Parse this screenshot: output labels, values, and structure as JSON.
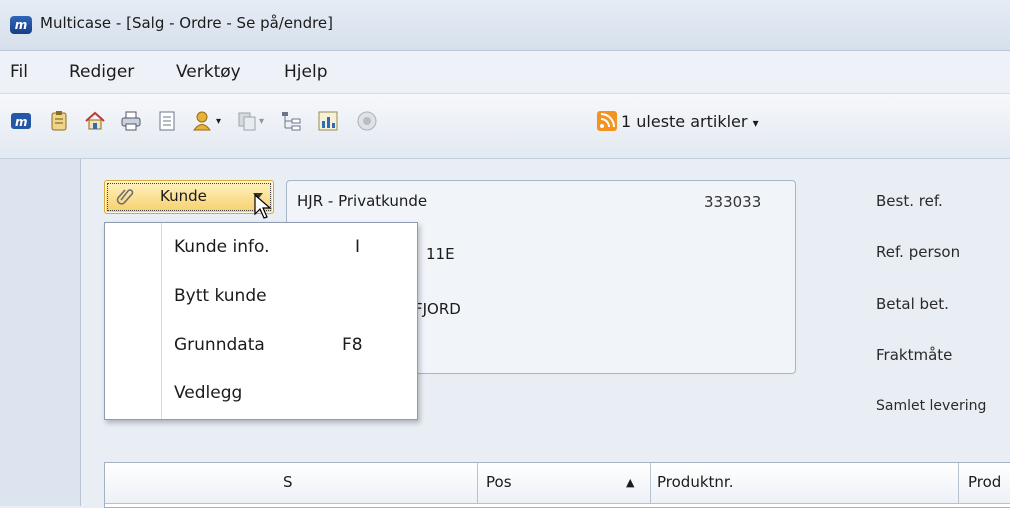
{
  "window": {
    "title": "Multicase - [Salg - Ordre - Se på/endre]",
    "app_icon_text": "m"
  },
  "menubar": {
    "items": [
      "Fil",
      "Rediger",
      "Verktøy",
      "Hjelp"
    ]
  },
  "toolbar": {
    "icons": [
      "multicase-icon",
      "clipboard-icon",
      "home-icon",
      "printer-icon",
      "document-icon",
      "user-icon",
      "copy-icon",
      "tree-icon",
      "chart-icon",
      "info-icon",
      "rss-icon"
    ],
    "rss_label": "1 uleste artikler",
    "rss_arrow": "▾"
  },
  "customer": {
    "button_label": "Kunde",
    "name": "HJR - Privatkunde",
    "number": "333033",
    "address_line1_partial": "11E",
    "address_line2_partial": "FJORD"
  },
  "dropdown": {
    "items": [
      {
        "label": "Kunde info.",
        "shortcut": "I"
      },
      {
        "label": "Bytt kunde",
        "shortcut": ""
      },
      {
        "label": "Grunndata",
        "shortcut": "F8"
      },
      {
        "label": "Vedlegg",
        "shortcut": ""
      }
    ]
  },
  "order_fields": [
    "Best. ref.",
    "Ref. person",
    "Betal bet.",
    "Fraktmåte",
    "Samlet levering"
  ],
  "grid": {
    "columns": [
      "S",
      "Pos",
      "Produktnr.",
      "Prod"
    ],
    "sort_indicator": "▲"
  },
  "colors": {
    "accent": "#f6cf6a",
    "title_icon": "#2f66b8",
    "rss": "#f29322"
  }
}
